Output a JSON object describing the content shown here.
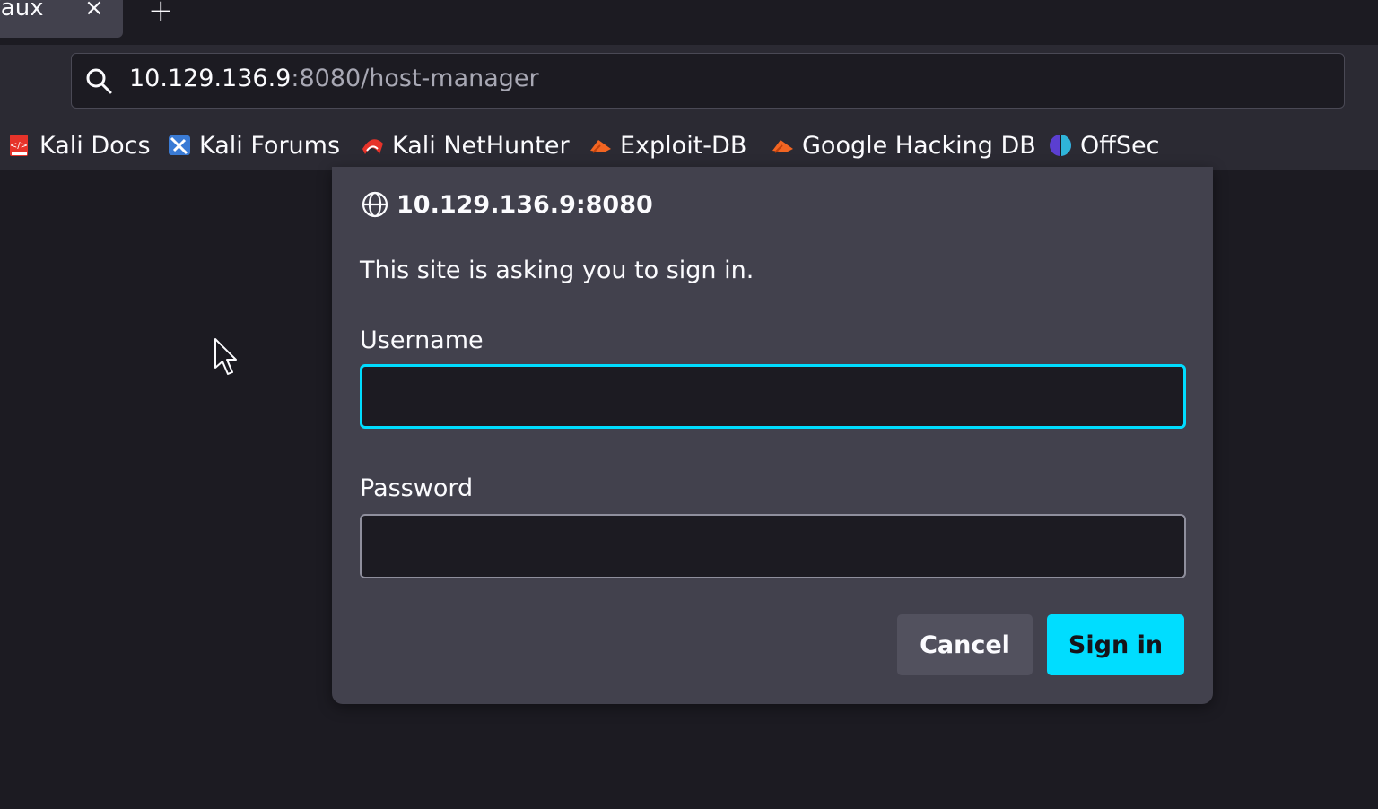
{
  "tabs": {
    "active_title": "/aux",
    "close_symbol": "×",
    "new_tab_symbol": "+"
  },
  "urlbar": {
    "host": "10.129.136.9",
    "path": ":8080/host-manager",
    "icon": "search-icon"
  },
  "bookmarks": [
    {
      "label": "Kali Docs",
      "icon": "kali-docs-icon"
    },
    {
      "label": "Kali Forums",
      "icon": "kali-forums-icon"
    },
    {
      "label": "Kali NetHunter",
      "icon": "kali-nethunter-icon"
    },
    {
      "label": "Exploit-DB",
      "icon": "exploit-db-icon"
    },
    {
      "label": "Google Hacking DB",
      "icon": "ghdb-icon"
    },
    {
      "label": "OffSec",
      "icon": "offsec-icon"
    }
  ],
  "dialog": {
    "site": "10.129.136.9:8080",
    "message": "This site is asking you to sign in.",
    "username_label": "Username",
    "username_value": "",
    "password_label": "Password",
    "password_value": "",
    "cancel_label": "Cancel",
    "signin_label": "Sign in"
  },
  "colors": {
    "accent": "#00ddff",
    "dialog_bg": "#42414d",
    "page_bg": "#1c1b22",
    "toolbar_bg": "#2b2a33"
  }
}
